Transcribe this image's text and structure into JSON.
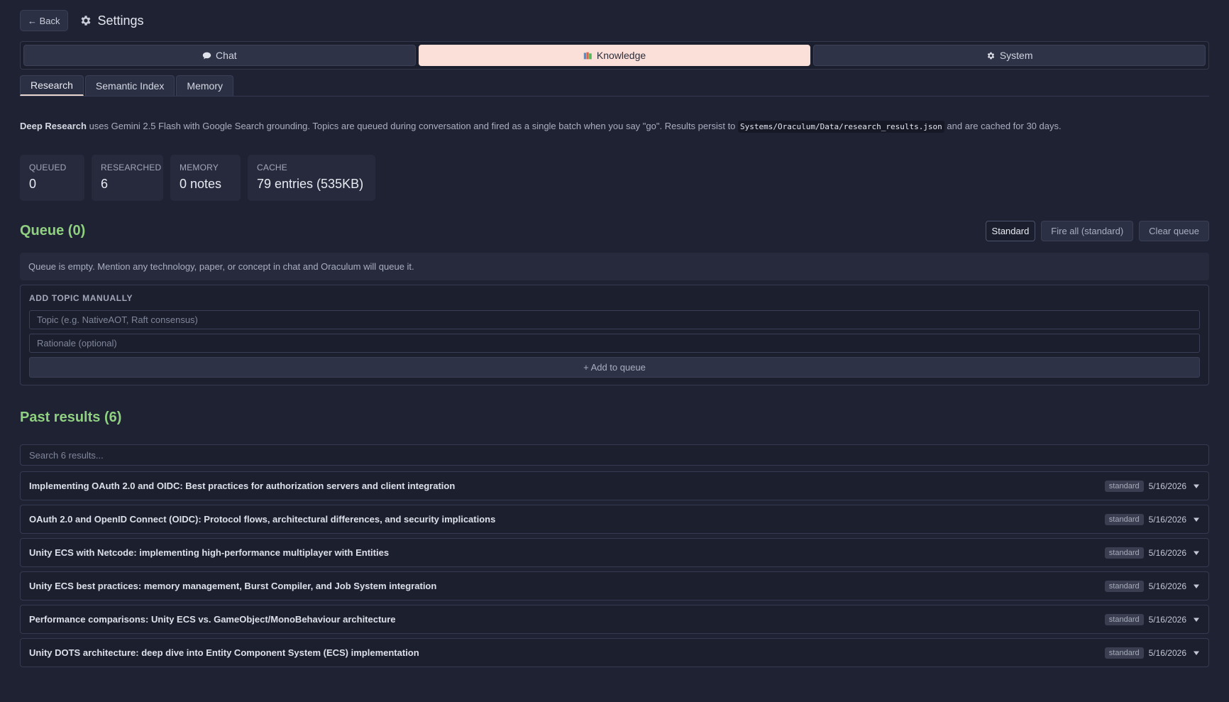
{
  "header": {
    "back_label": "← Back",
    "title": "Settings"
  },
  "main_tabs": [
    {
      "label": "Chat",
      "icon": "speech-bubble-icon",
      "active": false
    },
    {
      "label": "Knowledge",
      "icon": "books-icon",
      "active": true
    },
    {
      "label": "System",
      "icon": "gear-icon",
      "active": false
    }
  ],
  "sub_tabs": [
    {
      "label": "Research",
      "active": true
    },
    {
      "label": "Semantic Index",
      "active": false
    },
    {
      "label": "Memory",
      "active": false
    }
  ],
  "description": {
    "lead": "Deep Research",
    "text1": " uses Gemini 2.5 Flash with Google Search grounding. Topics are queued during conversation and fired as a single batch when you say \"go\". Results persist to ",
    "path": "Systems/Oraculum/Data/research_results.json",
    "text2": " and are cached for 30 days."
  },
  "stats": [
    {
      "label": "QUEUED",
      "value": "0"
    },
    {
      "label": "RESEARCHED",
      "value": "6"
    },
    {
      "label": "MEMORY",
      "value": "0 notes"
    },
    {
      "label": "CACHE",
      "value": "79 entries (535KB)"
    }
  ],
  "queue": {
    "title": "Queue (0)",
    "mode_label": "Standard",
    "fire_label": "Fire all (standard)",
    "clear_label": "Clear queue",
    "empty_text": "Queue is empty. Mention any technology, paper, or concept in chat and Oraculum will queue it."
  },
  "add_topic": {
    "title": "ADD TOPIC MANUALLY",
    "topic_placeholder": "Topic (e.g. NativeAOT, Raft consensus)",
    "topic_value": "",
    "rationale_placeholder": "Rationale (optional)",
    "rationale_value": "",
    "add_label": "+ Add to queue"
  },
  "past": {
    "title": "Past results (6)",
    "search_placeholder": "Search 6 results...",
    "search_value": "",
    "items": [
      {
        "title": "Implementing OAuth 2.0 and OIDC: Best practices for authorization servers and client integration",
        "badge": "standard",
        "date": "5/16/2026"
      },
      {
        "title": "OAuth 2.0 and OpenID Connect (OIDC): Protocol flows, architectural differences, and security implications",
        "badge": "standard",
        "date": "5/16/2026"
      },
      {
        "title": "Unity ECS with Netcode: implementing high-performance multiplayer with Entities",
        "badge": "standard",
        "date": "5/16/2026"
      },
      {
        "title": "Unity ECS best practices: memory management, Burst Compiler, and Job System integration",
        "badge": "standard",
        "date": "5/16/2026"
      },
      {
        "title": "Performance comparisons: Unity ECS vs. GameObject/MonoBehaviour architecture",
        "badge": "standard",
        "date": "5/16/2026"
      },
      {
        "title": "Unity DOTS architecture: deep dive into Entity Component System (ECS) implementation",
        "badge": "standard",
        "date": "5/16/2026"
      }
    ]
  },
  "colors": {
    "accent_green": "#8fd081",
    "active_tab_bg": "#fbe0d9",
    "background": "#1f2233"
  }
}
